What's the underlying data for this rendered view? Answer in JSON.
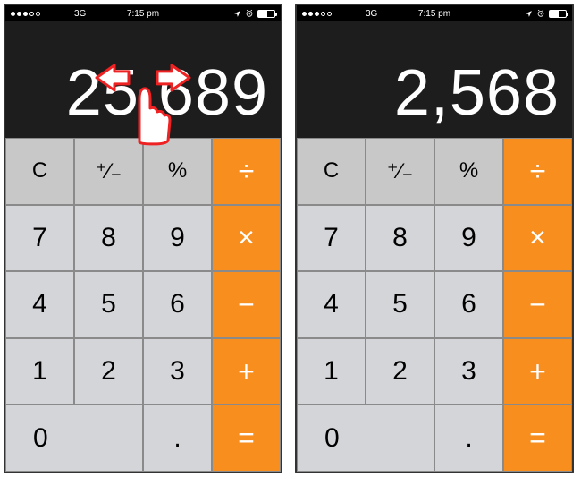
{
  "screens": [
    {
      "status": {
        "network": "3G",
        "time": "7:15 pm"
      },
      "display_value": "25,689",
      "show_swipe_gesture": true,
      "keys": {
        "clear": "C",
        "plusminus": "⁺∕₋",
        "percent": "%",
        "divide": "÷",
        "multiply": "×",
        "minus": "−",
        "plus": "+",
        "equals": "=",
        "seven": "7",
        "eight": "8",
        "nine": "9",
        "four": "4",
        "five": "5",
        "six": "6",
        "one": "1",
        "two": "2",
        "three": "3",
        "zero": "0",
        "decimal": "."
      }
    },
    {
      "status": {
        "network": "3G",
        "time": "7:15 pm"
      },
      "display_value": "2,568",
      "show_swipe_gesture": false,
      "keys": {
        "clear": "C",
        "plusminus": "⁺∕₋",
        "percent": "%",
        "divide": "÷",
        "multiply": "×",
        "minus": "−",
        "plus": "+",
        "equals": "=",
        "seven": "7",
        "eight": "8",
        "nine": "9",
        "four": "4",
        "five": "5",
        "six": "6",
        "one": "1",
        "two": "2",
        "three": "3",
        "zero": "0",
        "decimal": "."
      }
    }
  ]
}
